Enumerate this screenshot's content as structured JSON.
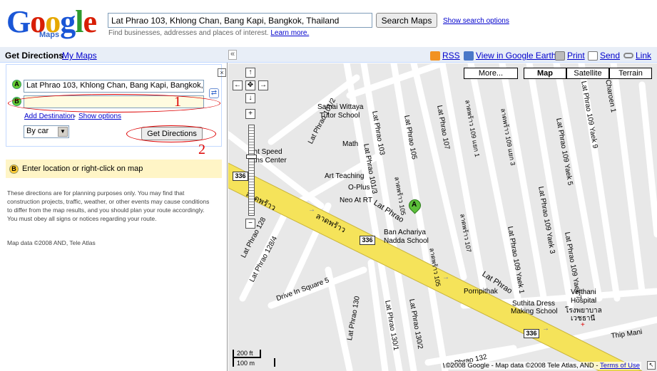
{
  "logo": {
    "word": "Google",
    "sub": "Maps"
  },
  "search": {
    "value": "Lat Phrao 103, Khlong Chan, Bang Kapi, Bangkok, Thailand",
    "button": "Search Maps",
    "options_link": "Show search options",
    "hint": "Find businesses, addresses and places of interest.",
    "learn_more": "Learn more."
  },
  "toolbar": {
    "title": "Get Directions",
    "my_maps": "My Maps",
    "collapse": "«",
    "rss": "RSS",
    "earth": "View in Google Earth",
    "print": "Print",
    "send": "Send",
    "link": "Link"
  },
  "directions": {
    "marker_a": "A",
    "marker_b": "B",
    "from_value": "Lat Phrao 103, Khlong Chan, Bang Kapi, Bangkok,",
    "to_value": "",
    "add_destination": "Add Destination",
    "separator": "-",
    "show_options": "Show options",
    "mode": "By car",
    "get_directions": "Get Directions",
    "close": "×"
  },
  "hint_box": {
    "marker": "B",
    "text": "Enter location or right-click on map"
  },
  "disclaimer": "These directions are for planning purposes only. You may find that construction projects, traffic, weather, or other events may cause conditions to differ from the map results, and you should plan your route accordingly. You must obey all signs or notices regarding your route.",
  "map_data": "Map data ©2008 AND, Tele Atlas",
  "annotations": {
    "one": "1",
    "two": "2"
  },
  "map": {
    "types": {
      "more": "More...",
      "map": "Map",
      "satellite": "Satellite",
      "terrain": "Terrain"
    },
    "active_type": "Map",
    "zoom": {
      "in": "+",
      "out": "−",
      "up": "↑",
      "down": "↓",
      "left": "←",
      "right": "→",
      "center": "✥"
    },
    "scale": {
      "ft": "200 ft",
      "m": "100 m"
    },
    "copyright": "©2008 Google - Map data ©2008 Tele Atlas, AND -",
    "terms": "Terms of Use",
    "marker": "A",
    "shield": "336",
    "places": {
      "samai": "Samai Wittaya",
      "tutor": "Tutor School",
      "math": "Math",
      "speed1": "ght Speed",
      "speed2": "aths Center",
      "art": "Art Teaching",
      "oplus": "O-Plus",
      "neo": "Neo At RT",
      "ban1": "Ban Achariya",
      "ban2": "Nadda School",
      "porn": "Pornpithak",
      "suthita1": "Suthita Dress",
      "suthita2": "Making School",
      "vej1": "Vejthani",
      "vej2": "Hospital",
      "vej3": "โรงพยาบาล",
      "vej4": "เวชธานี"
    },
    "roads": {
      "latphrao": "Lat Phrao",
      "latphrao_th": "ลาดพร้าว",
      "lp103": "Lat Phrao 103",
      "lp105": "Lat Phrao 105",
      "lp107": "Lat Phrao 107",
      "lp10112": "Lat Phrao 101/2",
      "lp1013": "Lat Phrao 101/3",
      "lp109y1": "Lat Phrao 109 Yaek 1",
      "lp109y3": "Lat Phrao 109 Yaek 3",
      "lp109y5": "Lat Phrao 109 Yaek 5",
      "lp109y7": "Lat Phrao 109 Yaek 7",
      "lp109y9": "Lat Phrao 109 Yaek 9",
      "lp1301": "Lat Phrao 130/1",
      "lp1302": "Lat Phrao 130/2",
      "lp130": "Lat Phrao 130",
      "lp132": "Lat Phrao 132",
      "lp1284": "Lat Phrao 128/4",
      "lp128": "Lat Phrao 128",
      "drive": "Drive In Square 5",
      "charoen": "Charoen 1",
      "thipmani": "Thip Mani",
      "th105": "ลาดพร้าว 105",
      "th109y1": "ลาดพร้าว 109 แยก 1",
      "th109y3": "ลาดพร้าว 109 แยก 3",
      "th107": "ลาดพร้าว 107"
    }
  }
}
